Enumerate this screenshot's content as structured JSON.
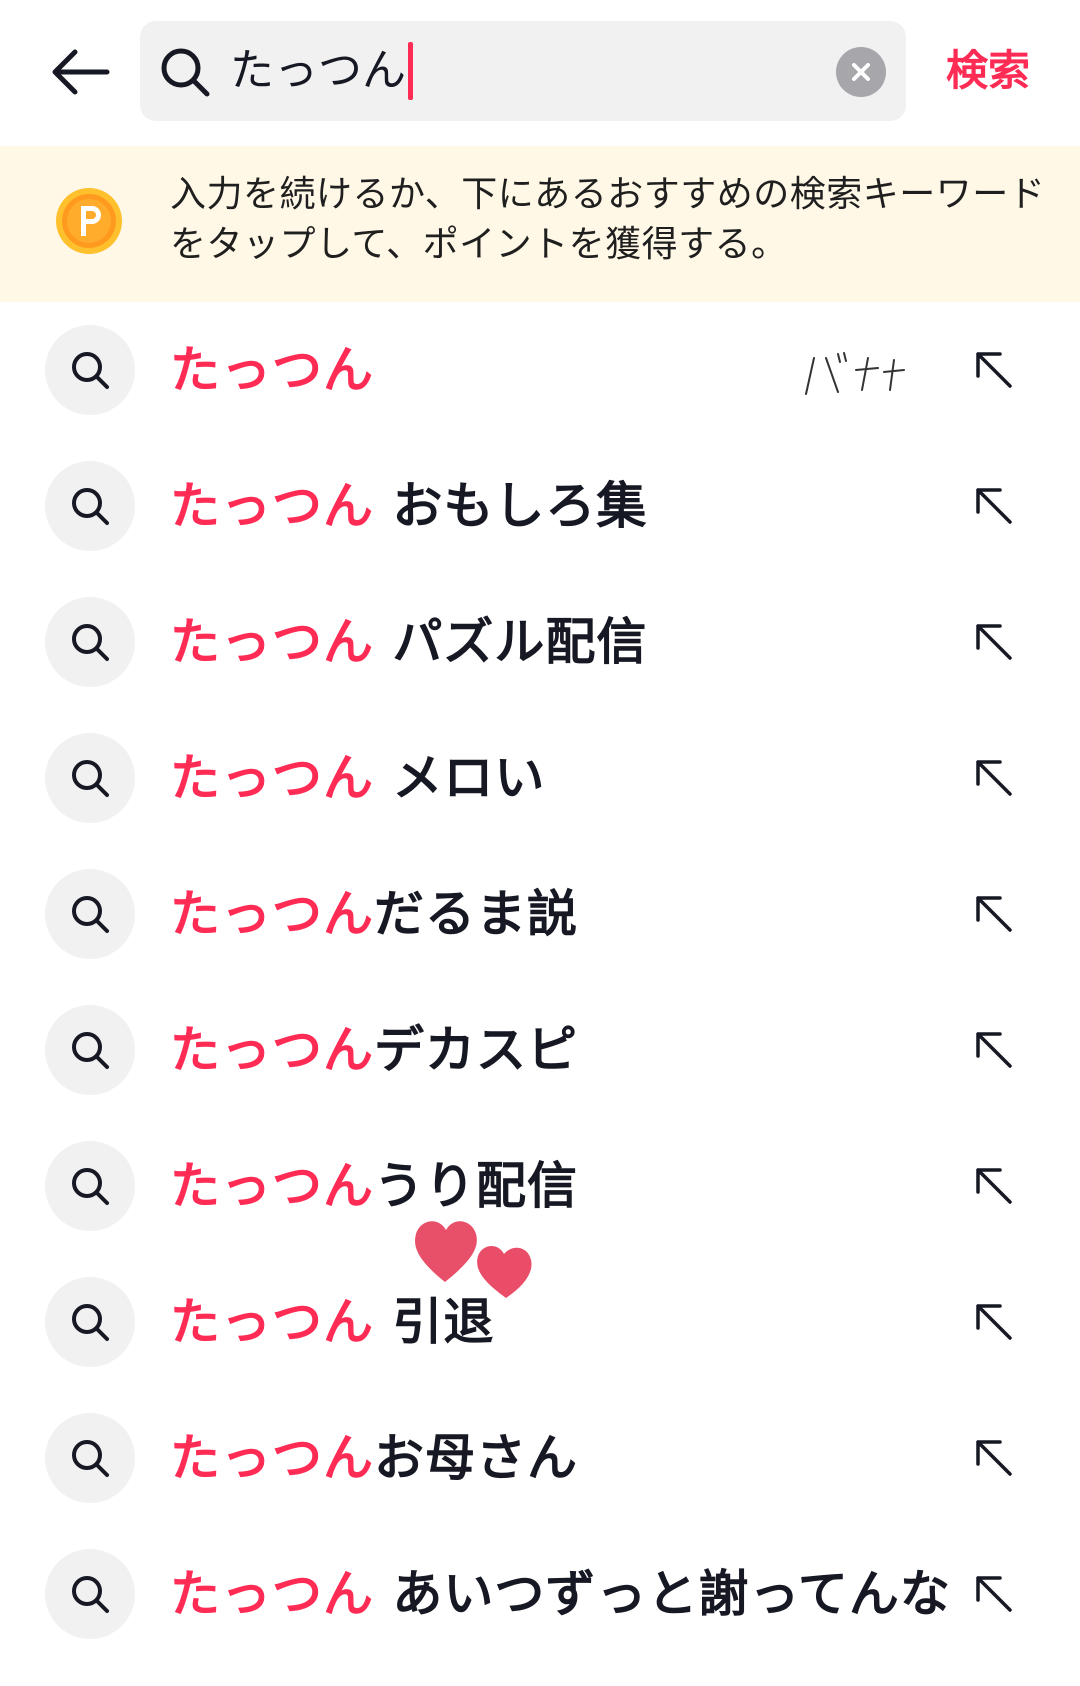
{
  "header": {
    "back_icon": "arrow-left-icon",
    "search_query": "たっつん",
    "clear_icon": "close-circle-icon",
    "submit_label": "検索",
    "accent_color": "#fe2c55"
  },
  "banner": {
    "coin_icon": "points-coin-icon",
    "text": "入力を続けるか、下にあるおすすめの検索キーワードをタップして、ポイントを獲得する。"
  },
  "suggestions": [
    {
      "highlight": "たっつん",
      "rest": ""
    },
    {
      "highlight": "たっつん",
      "rest": " おもしろ集"
    },
    {
      "highlight": "たっつん",
      "rest": " パズル配信"
    },
    {
      "highlight": "たっつん",
      "rest": " メロい"
    },
    {
      "highlight": "たっつん",
      "rest": "だるま説"
    },
    {
      "highlight": "たっつん",
      "rest": "デカスピ"
    },
    {
      "highlight": "たっつん",
      "rest": "うり配信"
    },
    {
      "highlight": "たっつん",
      "rest": " 引退"
    },
    {
      "highlight": "たっつん",
      "rest": "お母さん"
    },
    {
      "highlight": "たっつん",
      "rest": " あいつずっと謝ってんな"
    }
  ],
  "decorations": {
    "handwritten_note": "バナナ",
    "heart_stickers": "heart-sticker-icon"
  }
}
